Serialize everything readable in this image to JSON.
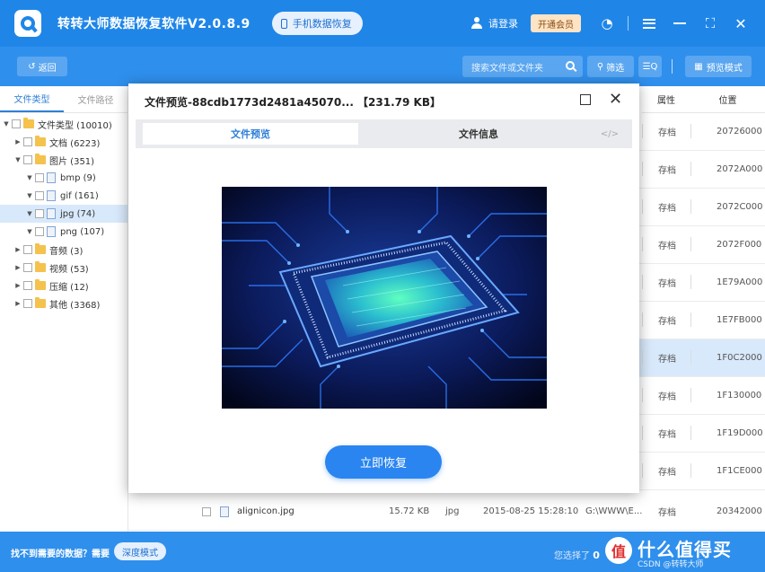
{
  "app": {
    "title": "转转大师数据恢复软件V2.0.8.9",
    "phone_recovery_label": "手机数据恢复",
    "login_label": "请登录",
    "vip_label": "开通会员"
  },
  "toolbar": {
    "back_label": "返回",
    "search_placeholder": "搜索文件或文件夹",
    "filter_label": "筛选",
    "list_label": "☰Q",
    "preview_mode_label": "预览模式"
  },
  "sidebar": {
    "tabs": [
      "文件类型",
      "文件路径"
    ],
    "tree": [
      {
        "label": "文件类型 (10010)",
        "level": 0,
        "expanded": true,
        "kind": "folder"
      },
      {
        "label": "文档 (6223)",
        "level": 1,
        "expanded": false,
        "kind": "folder"
      },
      {
        "label": "图片 (351)",
        "level": 1,
        "expanded": true,
        "kind": "folder"
      },
      {
        "label": "bmp (9)",
        "level": 2,
        "expanded": true,
        "kind": "file"
      },
      {
        "label": "gif (161)",
        "level": 2,
        "expanded": true,
        "kind": "file"
      },
      {
        "label": "jpg (74)",
        "level": 2,
        "expanded": true,
        "kind": "file",
        "selected": true
      },
      {
        "label": "png (107)",
        "level": 2,
        "expanded": true,
        "kind": "file"
      },
      {
        "label": "音频 (3)",
        "level": 1,
        "expanded": false,
        "kind": "folder"
      },
      {
        "label": "视频 (53)",
        "level": 1,
        "expanded": false,
        "kind": "folder"
      },
      {
        "label": "压缩 (12)",
        "level": 1,
        "expanded": false,
        "kind": "folder"
      },
      {
        "label": "其他 (3368)",
        "level": 1,
        "expanded": false,
        "kind": "folder"
      }
    ]
  },
  "table": {
    "headers": {
      "attr": "属性",
      "position": "位置"
    },
    "rows": [
      {
        "attr": "存档",
        "position": "20726000"
      },
      {
        "attr": "存档",
        "position": "2072A000"
      },
      {
        "attr": "存档",
        "position": "2072C000"
      },
      {
        "attr": "存档",
        "position": "2072F000"
      },
      {
        "attr": "存档",
        "position": "1E79A000"
      },
      {
        "attr": "存档",
        "position": "1E7FB000"
      },
      {
        "attr": "存档",
        "position": "1F0C2000",
        "highlight": true
      },
      {
        "attr": "存档",
        "position": "1F130000"
      },
      {
        "attr": "存档",
        "position": "1F19D000"
      },
      {
        "attr": "存档",
        "position": "1F1CE000"
      }
    ],
    "last_row": {
      "name": "alignicon.jpg",
      "size": "15.72 KB",
      "type": "jpg",
      "date": "2015-08-25 15:28:10",
      "path": "G:\\WWW\\E...",
      "attr": "存档",
      "position": "20342000"
    }
  },
  "modal": {
    "title": "文件预览-88cdb1773d2481a45070...  【231.79 KB】",
    "tab_preview": "文件预览",
    "tab_info": "文件信息",
    "tab_code": "</>",
    "restore_label": "立即恢复"
  },
  "bottom": {
    "hint": "找不到需要的数据？需要",
    "deep_mode_label": "深度模式",
    "selected_prefix": "您选择了",
    "selected_count": "0",
    "watermark_logo": "值",
    "watermark_text": "什么值得买",
    "watermark_csdn": "CSDN @转转大师"
  },
  "colors": {
    "primary": "#1f86e8",
    "toolbar": "#2f8fec",
    "selection": "#d8e9fb",
    "restore_button": "#2a85f0"
  },
  "icons": [
    "app-logo-icon",
    "phone-icon",
    "user-icon",
    "help-icon",
    "menu-icon",
    "minimize-icon",
    "maximize-icon",
    "close-icon",
    "search-icon",
    "filter-icon",
    "grid-icon",
    "folder-icon",
    "file-icon",
    "checkbox-icon"
  ]
}
